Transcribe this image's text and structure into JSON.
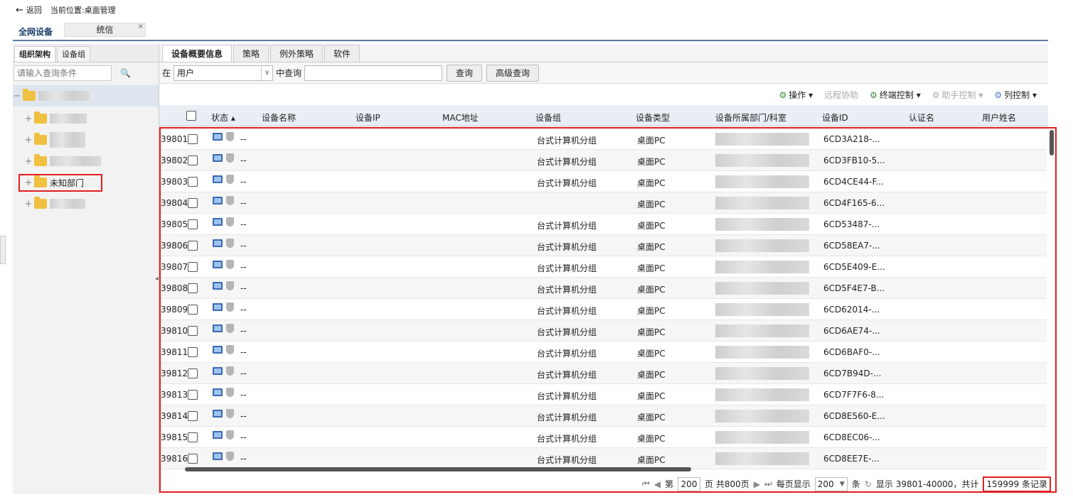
{
  "topbar": {
    "back_label": "返回",
    "location": "当前位置:桌面管理"
  },
  "top_tabs": {
    "all_devices": "全网设备",
    "open_tab": "统信",
    "close": "×"
  },
  "left_panel": {
    "tabs": [
      "组织架构",
      "设备组"
    ],
    "search_placeholder": "请输入查询条件",
    "tree": {
      "unknown_dept": "未知部门",
      "expand": "+",
      "collapse": "−"
    }
  },
  "main_tabs": [
    "设备概要信息",
    "策略",
    "例外策略",
    "软件"
  ],
  "query": {
    "prefix": "在",
    "field": "用户",
    "middle": "中查询",
    "search": "查询",
    "advanced": "高级查询"
  },
  "toolbar": {
    "operate": "操作",
    "remote": "远程协助",
    "terminal": "终端控制",
    "assistant": "助手控制",
    "columns": "列控制"
  },
  "columns": {
    "status": "状态",
    "name": "设备名称",
    "ip": "设备IP",
    "mac": "MAC地址",
    "group": "设备组",
    "type": "设备类型",
    "dept": "设备所属部门/科室",
    "id": "设备ID",
    "auth": "认证名",
    "user": "用户姓名"
  },
  "rows": [
    {
      "no": "39801",
      "status": "--",
      "group": "台式计算机分组",
      "type": "桌面PC",
      "id": "6CD3A218-..."
    },
    {
      "no": "39802",
      "status": "--",
      "group": "台式计算机分组",
      "type": "桌面PC",
      "id": "6CD3FB10-5..."
    },
    {
      "no": "39803",
      "status": "--",
      "group": "台式计算机分组",
      "type": "桌面PC",
      "id": "6CD4CE44-F..."
    },
    {
      "no": "39804",
      "status": "--",
      "group": "",
      "type": "桌面PC",
      "id": "6CD4F165-6..."
    },
    {
      "no": "39805",
      "status": "--",
      "group": "台式计算机分组",
      "type": "桌面PC",
      "id": "6CD53487-..."
    },
    {
      "no": "39806",
      "status": "--",
      "group": "台式计算机分组",
      "type": "桌面PC",
      "id": "6CD58EA7-..."
    },
    {
      "no": "39807",
      "status": "--",
      "group": "台式计算机分组",
      "type": "桌面PC",
      "id": "6CD5E409-E..."
    },
    {
      "no": "39808",
      "status": "--",
      "group": "台式计算机分组",
      "type": "桌面PC",
      "id": "6CD5F4E7-B..."
    },
    {
      "no": "39809",
      "status": "--",
      "group": "台式计算机分组",
      "type": "桌面PC",
      "id": "6CD62014-..."
    },
    {
      "no": "39810",
      "status": "--",
      "group": "台式计算机分组",
      "type": "桌面PC",
      "id": "6CD6AE74-..."
    },
    {
      "no": "39811",
      "status": "--",
      "group": "台式计算机分组",
      "type": "桌面PC",
      "id": "6CD6BAF0-..."
    },
    {
      "no": "39812",
      "status": "--",
      "group": "台式计算机分组",
      "type": "桌面PC",
      "id": "6CD7B94D-..."
    },
    {
      "no": "39813",
      "status": "--",
      "group": "台式计算机分组",
      "type": "桌面PC",
      "id": "6CD7F7F6-8..."
    },
    {
      "no": "39814",
      "status": "--",
      "group": "台式计算机分组",
      "type": "桌面PC",
      "id": "6CD8E560-E..."
    },
    {
      "no": "39815",
      "status": "--",
      "group": "台式计算机分组",
      "type": "桌面PC",
      "id": "6CD8EC06-..."
    },
    {
      "no": "39816",
      "status": "--",
      "group": "台式计算机分组",
      "type": "桌面PC",
      "id": "6CD8EE7E-..."
    }
  ],
  "pager": {
    "page_prefix": "第",
    "page": "200",
    "page_suffix": "页 共800页",
    "per_page_label": "每页显示",
    "per_page": "200",
    "unit": "条",
    "display": "显示 39801-40000，共计",
    "total": "159999 条记录"
  }
}
